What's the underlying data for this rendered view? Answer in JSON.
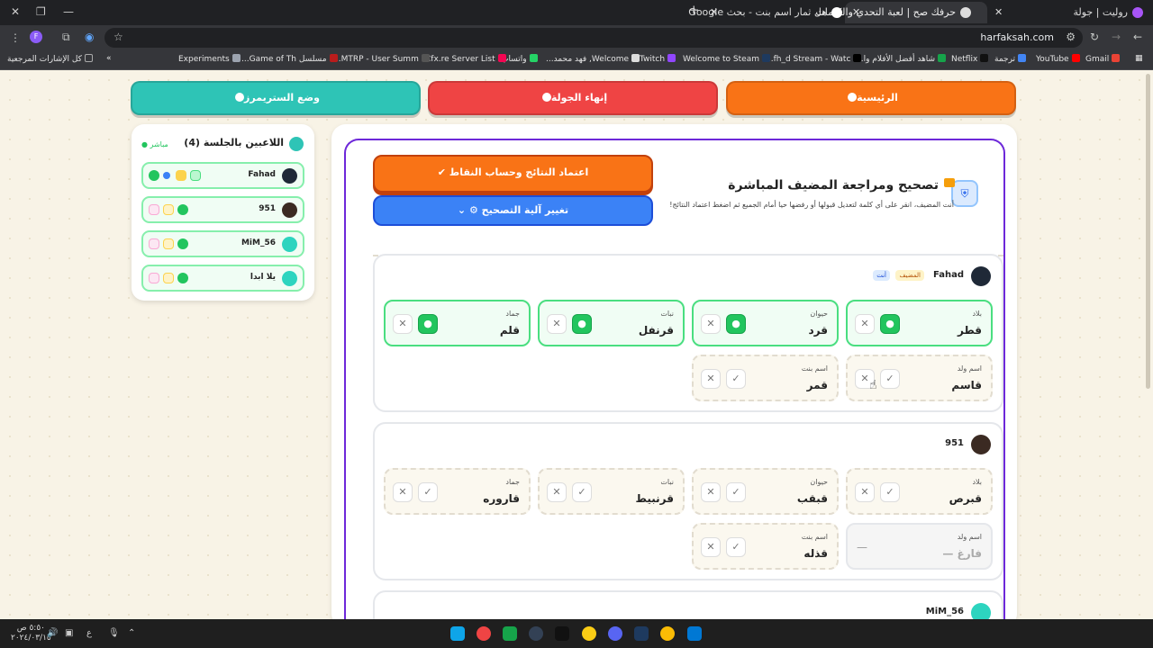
{
  "browser": {
    "tabs": [
      {
        "title": "روليت | جولة",
        "active": false
      },
      {
        "title": "حرفك صح | لعبة التحدي والكلمات",
        "active": true
      },
      {
        "title": "هل ثمار اسم بنت - بحث Google",
        "active": false
      }
    ],
    "url": "harfaksah.com",
    "profile": "F",
    "bookmarks": [
      "Gmail",
      "YouTube",
      "ترجمة",
      "Netflix",
      "شاهد أفضل الأفلام وا...",
      "fh_d Stream - Watc...",
      "Welcome to Steam",
      "Twitch",
      "Welcome, فهد محمد...",
      "واتساب",
      "Cfx.re Server List",
      "MTRP - User Summ...",
      "مسلسل Game of Th...",
      "Experiments"
    ],
    "all_bookmarks": "كل الإشارات المرجعية"
  },
  "nav": {
    "home": "الرئيسية",
    "end_round": "إنهاء الجولة",
    "streamer_mode": "وضع الستريمرز"
  },
  "players_panel": {
    "title": "اللاعبين بالجلسة (4)",
    "live": "مباشر",
    "players": [
      {
        "name": "Fahad",
        "color": "#1f2937"
      },
      {
        "name": "951",
        "color": "#3b2a22"
      },
      {
        "name": "MiM_56",
        "color": "#2dd4bf"
      },
      {
        "name": "يلا ابدا",
        "color": "#2dd4bf"
      }
    ]
  },
  "review": {
    "title": "تصحيح ومراجعة المضيف المباشرة",
    "subtitle": "أنت المضيف، انقر على أي كلمة لتعديل قبولها أو رفضها حيا أمام الجميع ثم اضغط اعتماد النتائج!",
    "approve_button": "اعتماد النتائج وحساب النقاط",
    "change_button": "تغيير آلية التصحيح"
  },
  "cards": [
    {
      "player": "Fahad",
      "host_badge": "المضيف",
      "you_badge": "أنت",
      "answers": [
        {
          "label": "بلاد",
          "value": "قطر",
          "state": "ok"
        },
        {
          "label": "حيوان",
          "value": "قرد",
          "state": "ok"
        },
        {
          "label": "نبات",
          "value": "قرنفل",
          "state": "ok"
        },
        {
          "label": "جماد",
          "value": "قلم",
          "state": "ok"
        },
        {
          "label": "اسم ولد",
          "value": "قاسم",
          "state": "pending"
        },
        {
          "label": "اسم بنت",
          "value": "قمر",
          "state": "pending"
        }
      ]
    },
    {
      "player": "951",
      "answers": [
        {
          "label": "بلاد",
          "value": "قبرص",
          "state": "pending"
        },
        {
          "label": "حيوان",
          "value": "قبقب",
          "state": "pending"
        },
        {
          "label": "نبات",
          "value": "قرنبيط",
          "state": "pending"
        },
        {
          "label": "جماد",
          "value": "قاروره",
          "state": "pending"
        },
        {
          "label": "اسم ولد",
          "value": "— فارغ",
          "state": "empty"
        },
        {
          "label": "اسم بنت",
          "value": "قذله",
          "state": "pending"
        }
      ]
    },
    {
      "player": "MiM_56",
      "answers": []
    }
  ],
  "taskbar": {
    "time": "٥:٥٠ ص",
    "date": "٢٠٢٤/٠٣/١٥",
    "lang": "ع"
  }
}
